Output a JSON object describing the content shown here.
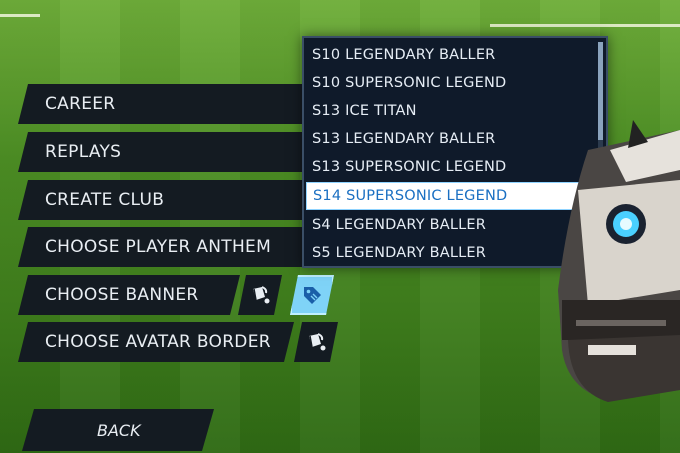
{
  "menu": {
    "items": [
      {
        "label": "CAREER"
      },
      {
        "label": "REPLAYS"
      },
      {
        "label": "CREATE CLUB"
      },
      {
        "label": "CHOOSE PLAYER ANTHEM"
      },
      {
        "label": "CHOOSE BANNER"
      },
      {
        "label": "CHOOSE AVATAR BORDER"
      }
    ],
    "back_label": "BACK"
  },
  "dropdown": {
    "options": [
      "S10 LEGENDARY BALLER",
      "S10 SUPERSONIC LEGEND",
      "S13 ICE TITAN",
      "S13 LEGENDARY BALLER",
      "S13 SUPERSONIC LEGEND",
      "S14 SUPERSONIC LEGEND",
      "S4 LEGENDARY BALLER",
      "S5 LEGENDARY BALLER"
    ],
    "selected": "S14 SUPERSONIC LEGEND"
  },
  "icons": {
    "banner_paint": "paint-bucket-icon",
    "banner_tag": "tag-icon",
    "border_paint": "paint-bucket-icon"
  },
  "colors": {
    "menu_bg": "#141b22",
    "selected_text": "#1a6fc2",
    "active_icon_bg": "#7fd3f7"
  }
}
